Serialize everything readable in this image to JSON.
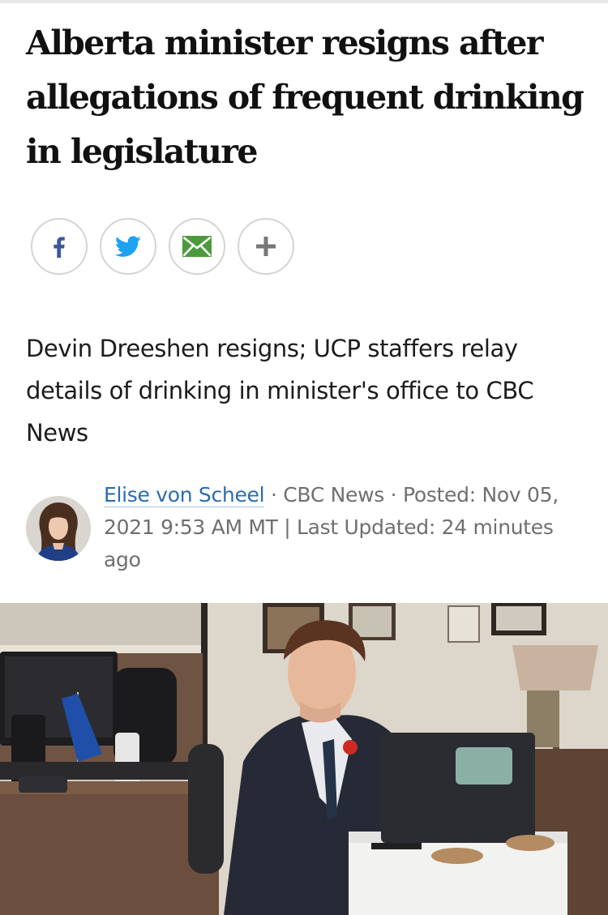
{
  "article": {
    "headline": "Alberta minister resigns after allegations of frequent drinking in legislature",
    "dek": "Devin Dreeshen resigns; UCP staffers relay details of drinking in minister's office to CBC News"
  },
  "share": {
    "buttons": [
      {
        "icon": "facebook-icon",
        "color": "#3b5998"
      },
      {
        "icon": "twitter-icon",
        "color": "#1da1f2"
      },
      {
        "icon": "email-icon",
        "color": "#4c9a3d"
      },
      {
        "icon": "plus-icon",
        "color": "#777777"
      }
    ]
  },
  "byline": {
    "author": "Elise von Scheel",
    "separator1": " · ",
    "outlet": "CBC News",
    "separator2": " · ",
    "posted": "Posted: Nov 05, 2021 9:53 AM MT | Last Updated: 24 minutes ago"
  },
  "colors": {
    "link": "#2b6cb0",
    "headline_text": "#111111",
    "meta_text": "#6f6f6f"
  }
}
